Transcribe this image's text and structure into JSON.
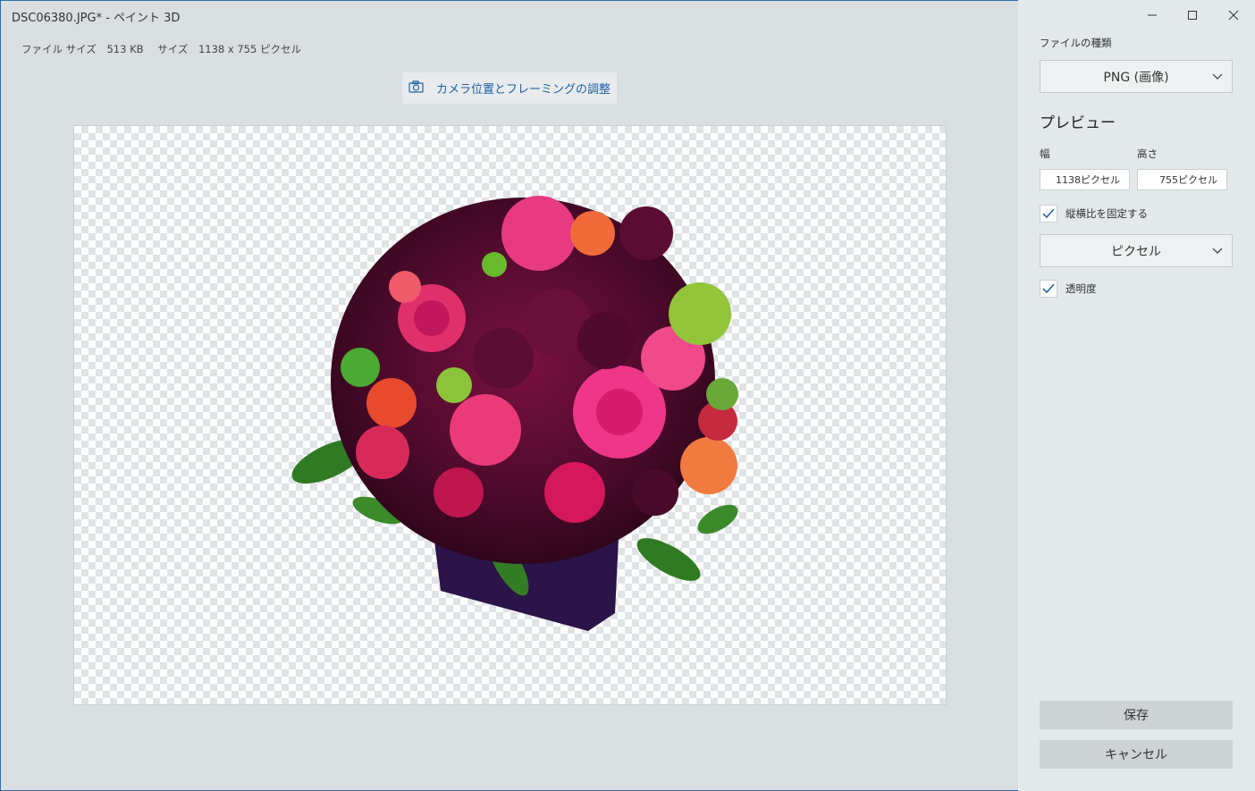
{
  "window": {
    "title": "DSC06380.JPG* - ペイント 3D"
  },
  "fileinfo": {
    "file_size_label": "ファイル サイズ",
    "file_size_value": "513 KB",
    "size_label": "サイズ",
    "size_value": "1138 x 755 ピクセル"
  },
  "camera_button": {
    "label": "カメラ位置とフレーミングの調整",
    "icon": "camera-icon"
  },
  "panel": {
    "file_type_label": "ファイルの種類",
    "file_type_value": "PNG (画像)",
    "preview_title": "プレビュー",
    "width_label": "幅",
    "height_label": "高さ",
    "width_value": "1138ピクセル",
    "height_value": "755ピクセル",
    "lock_aspect_label": "縦横比を固定する",
    "lock_aspect_checked": true,
    "unit_value": "ピクセル",
    "transparency_label": "透明度",
    "transparency_checked": true,
    "save_label": "保存",
    "cancel_label": "キャンセル"
  },
  "colors": {
    "accent": "#1f5fa0",
    "panel_bg": "#e3e8ea",
    "workspace_bg": "#d9dfe1"
  }
}
